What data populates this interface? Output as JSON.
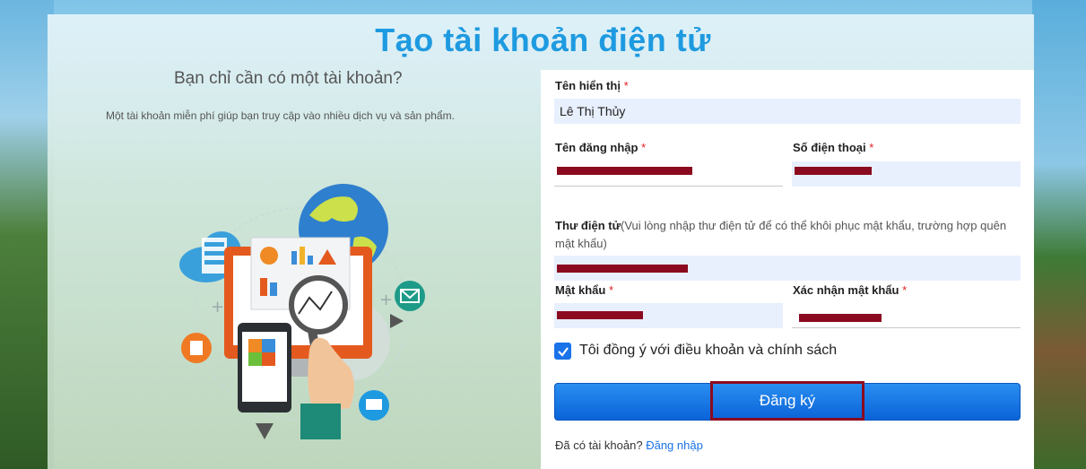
{
  "page": {
    "title": "Tạo tài khoản điện tử"
  },
  "left": {
    "heading": "Bạn chỉ cần có một tài khoản?",
    "subtext": "Một tài khoản miễn phí giúp bạn truy cập vào nhiều dịch vụ và sản phẩm."
  },
  "form": {
    "display_name": {
      "label": "Tên hiển thị",
      "required": "*",
      "value": "Lê Thị Thủy"
    },
    "username": {
      "label": "Tên đăng nhập",
      "required": "*",
      "value": ""
    },
    "phone": {
      "label": "Số điện thoại",
      "required": "*",
      "value": ""
    },
    "email": {
      "label": "Thư điện tử",
      "hint": "(Vui lòng nhập thư điện tử để có thể khôi phục mật khẩu, trường hợp quên mật khẩu)",
      "value": ""
    },
    "password": {
      "label": "Mật khẩu",
      "required": "*",
      "value": ""
    },
    "confirm_password": {
      "label": "Xác nhận mật khẩu",
      "required": "*",
      "value": ""
    },
    "agree": {
      "label": "Tôi đồng ý với điều khoản và chính sách",
      "checked": true
    },
    "submit_label": "Đăng ký",
    "login_prompt": "Đã có tài khoản?",
    "login_link": "Đăng nhập"
  },
  "icons": [
    "cloud-server-icon",
    "globe-icon",
    "mail-icon",
    "chart-icon",
    "magnifier-icon",
    "puzzle-icon",
    "monitor-icon",
    "pie-report-icon"
  ],
  "colors": {
    "title": "#1e9ae0",
    "button": "#0a63d8",
    "required": "#e02020",
    "link": "#1a73e8",
    "redaction": "#8b0a1f"
  }
}
